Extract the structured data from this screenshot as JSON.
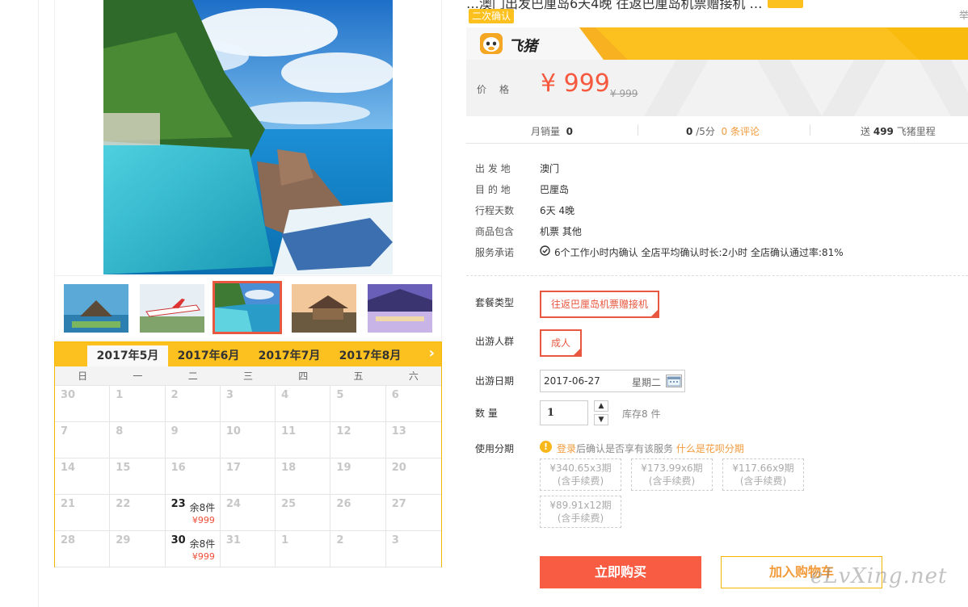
{
  "header": {
    "title_cut": "…澳门出发巴厘岛6天4晚  往返巴厘岛机票赠接机 …",
    "report": "举",
    "confirm_badge": "二次确认"
  },
  "brand": {
    "name": "飞猪",
    "logo_icon": "fliggy-pig-logo-icon",
    "accent": "#fdc11f"
  },
  "price": {
    "label": "价格",
    "current": "¥ 999",
    "original": "¥ 999",
    "accent": "#f7593f"
  },
  "stats": {
    "monthly_sales_label": "月销量",
    "monthly_sales_value": "0",
    "rating_value": "0",
    "rating_suffix": "/5分",
    "reviews_link": "0 条评论",
    "points_prefix": "送",
    "points_value": "499",
    "points_suffix": "飞猪里程"
  },
  "info": [
    {
      "label": "出 发 地",
      "value": "澳门"
    },
    {
      "label": "目 的 地",
      "value": "巴厘岛"
    },
    {
      "label": "行程天数",
      "value": "6天 4晚"
    },
    {
      "label": "商品包含",
      "value": "机票  其他"
    },
    {
      "label": "服务承诺",
      "value": "6个工作小时内确认     全店平均确认时长:2小时     全店确认通过率:81%"
    }
  ],
  "options": {
    "package_label": "套餐类型",
    "package_value": "往返巴厘岛机票赠接机",
    "crowd_label": "出游人群",
    "crowd_value": "成人",
    "date_label": "出游日期",
    "date_value": "2017-06-27",
    "date_weekday": "星期二",
    "qty_label": "数      量",
    "qty_value": "1",
    "stock": "库存8 件",
    "installment_label": "使用分期"
  },
  "alert": {
    "login": "登录",
    "text": "后确认是否享有该服务",
    "link": "什么是花呗分期"
  },
  "installments": [
    {
      "amount": "¥340.65",
      "period": "x3期",
      "fee": "(含手续费)"
    },
    {
      "amount": "¥173.99",
      "period": "x6期",
      "fee": "(含手续费)"
    },
    {
      "amount": "¥117.66",
      "period": "x9期",
      "fee": "(含手续费)"
    },
    {
      "amount": "¥89.91",
      "period": "x12期",
      "fee": "(含手续费)"
    }
  ],
  "actions": {
    "buy": "立即购买",
    "cart": "加入购物车"
  },
  "watermark": "eLvXing.net",
  "calendar": {
    "months": [
      "2017年5月",
      "2017年6月",
      "2017年7月",
      "2017年8月"
    ],
    "active_month": 0,
    "weekdays": [
      "日",
      "一",
      "二",
      "三",
      "四",
      "五",
      "六"
    ],
    "days": [
      {
        "d": "30"
      },
      {
        "d": "1"
      },
      {
        "d": "2"
      },
      {
        "d": "3"
      },
      {
        "d": "4"
      },
      {
        "d": "5"
      },
      {
        "d": "6"
      },
      {
        "d": "7"
      },
      {
        "d": "8"
      },
      {
        "d": "9"
      },
      {
        "d": "10"
      },
      {
        "d": "11"
      },
      {
        "d": "12"
      },
      {
        "d": "13"
      },
      {
        "d": "14"
      },
      {
        "d": "15"
      },
      {
        "d": "16"
      },
      {
        "d": "17"
      },
      {
        "d": "18"
      },
      {
        "d": "19"
      },
      {
        "d": "20"
      },
      {
        "d": "21"
      },
      {
        "d": "22"
      },
      {
        "d": "23",
        "stock": "余8件",
        "price": "¥999"
      },
      {
        "d": "24"
      },
      {
        "d": "25"
      },
      {
        "d": "26"
      },
      {
        "d": "27"
      },
      {
        "d": "28"
      },
      {
        "d": "29"
      },
      {
        "d": "30",
        "stock": "余8件",
        "price": "¥999"
      },
      {
        "d": "31"
      },
      {
        "d": "1"
      },
      {
        "d": "2"
      },
      {
        "d": "3"
      }
    ]
  }
}
